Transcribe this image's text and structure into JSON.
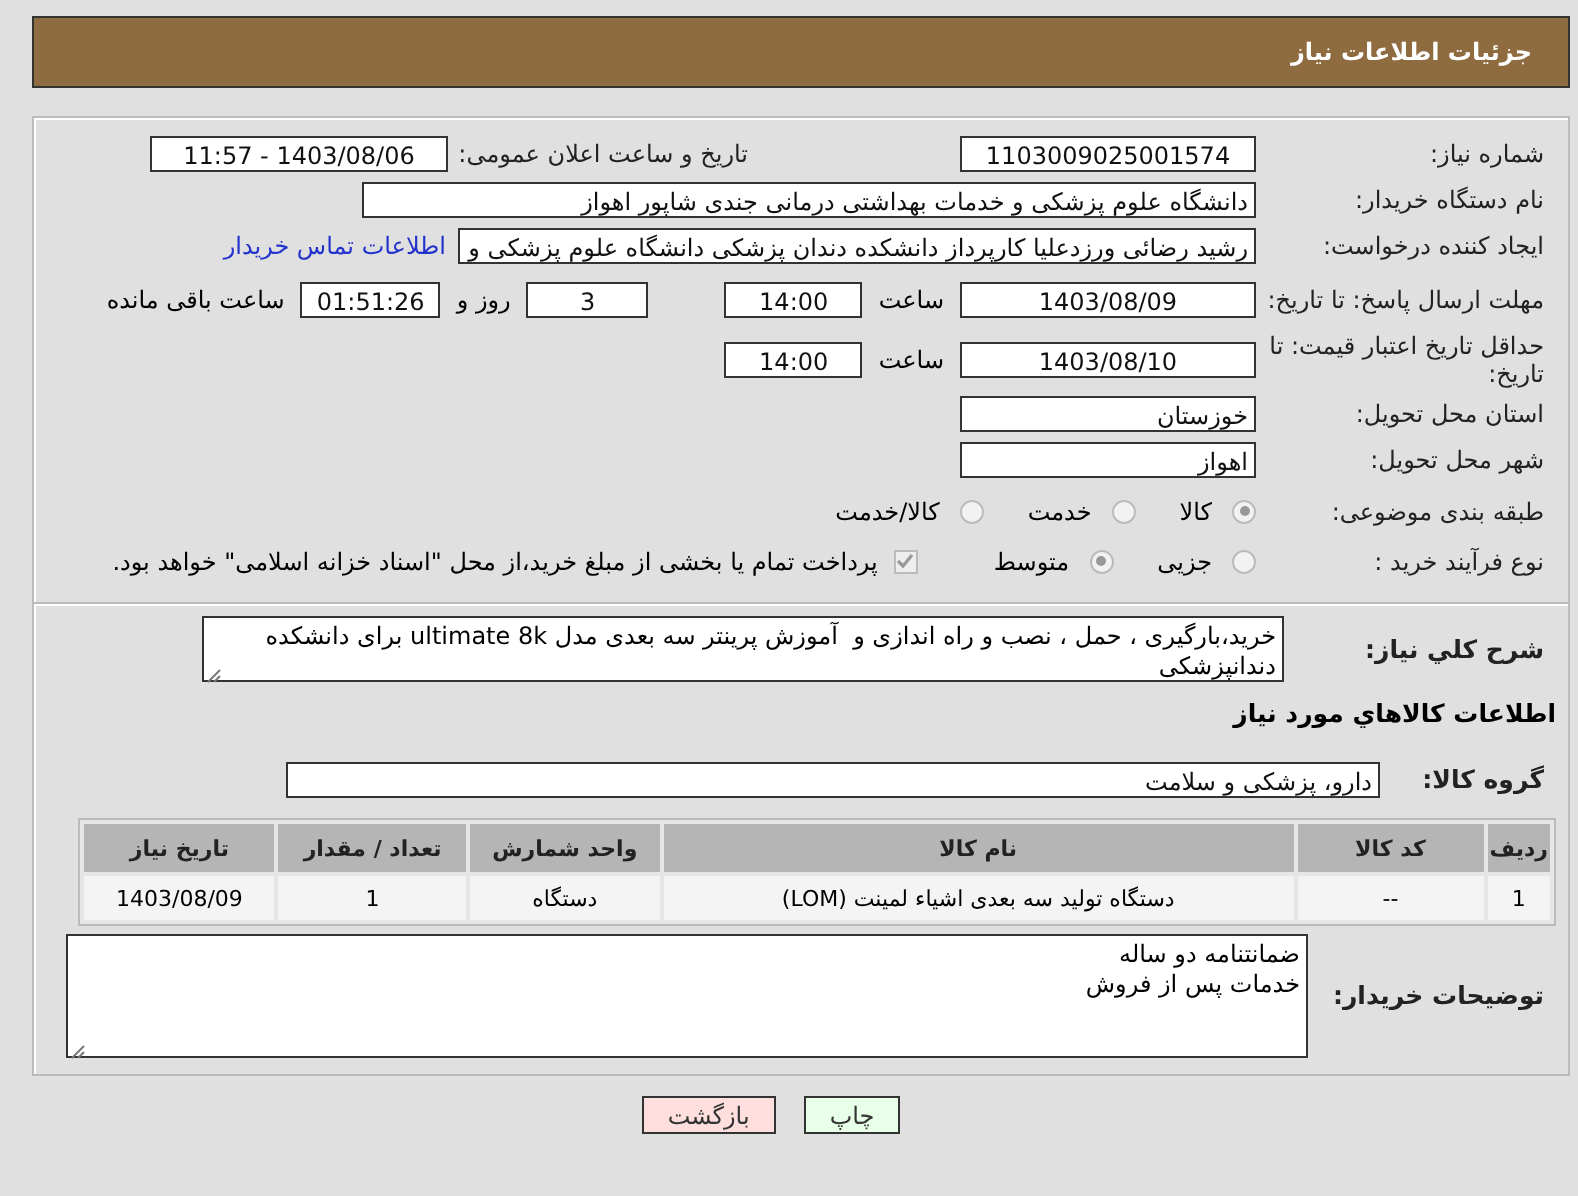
{
  "header": {
    "title": "جزئیات اطلاعات نیاز"
  },
  "need_number": {
    "label": "شماره نیاز:",
    "value": "1103009025001574"
  },
  "announce": {
    "label": "تاریخ و ساعت اعلان عمومی:",
    "value": "1403/08/06 - 11:57"
  },
  "buyer": {
    "label": "نام دستگاه خریدار:",
    "value": "دانشگاه علوم پزشکی و خدمات بهداشتی درمانی جندی شاپور اهواز"
  },
  "requester": {
    "label": "ایجاد کننده درخواست:",
    "value": "رشید رضائی ورزدعلیا کارپرداز دانشکده دندان پزشکی دانشگاه علوم پزشکی و",
    "link": "اطلاعات تماس خریدار"
  },
  "deadline": {
    "label": "مهلت ارسال پاسخ: تا تاریخ:",
    "date": "1403/08/09",
    "time_label": "ساعت",
    "time": "14:00",
    "days": "3",
    "days_label": "روز و",
    "remaining": "01:51:26",
    "remaining_label": "ساعت باقی مانده"
  },
  "price_validity": {
    "label": "حداقل تاریخ اعتبار قیمت: تا تاریخ:",
    "date": "1403/08/10",
    "time_label": "ساعت",
    "time": "14:00"
  },
  "province": {
    "label": "استان محل تحویل:",
    "value": "خوزستان"
  },
  "city": {
    "label": "شهر محل تحویل:",
    "value": "اهواز"
  },
  "category": {
    "label": "طبقه بندی موضوعی:",
    "options": [
      {
        "label": "کالا",
        "selected": true
      },
      {
        "label": "خدمت",
        "selected": false
      },
      {
        "label": "کالا/خدمت",
        "selected": false
      }
    ]
  },
  "process": {
    "label": "نوع فرآیند خرید :",
    "options": [
      {
        "label": "جزیی",
        "selected": false
      },
      {
        "label": "متوسط",
        "selected": true
      }
    ],
    "payment": {
      "label": "پرداخت تمام یا بخشی از مبلغ خرید،از محل \"اسناد خزانه اسلامی\" خواهد بود.",
      "checked": true
    }
  },
  "description": {
    "label": "شرح کلي نياز:",
    "value": "خرید،بارگیری ، حمل ، نصب و راه اندازی و  آموزش پرینتر سه بعدی مدل ultimate 8k برای دانشکده دندانپزشکی"
  },
  "goods_heading": "اطلاعات کالاهاي مورد نياز",
  "group": {
    "label": "گروه کالا:",
    "value": "دارو، پزشکی و سلامت"
  },
  "table": {
    "columns": [
      "ردیف",
      "کد کالا",
      "نام کالا",
      "واحد شمارش",
      "تعداد / مقدار",
      "تاریخ نیاز"
    ],
    "rows": [
      [
        "1",
        "--",
        "دستگاه تولید سه بعدی اشیاء لمینت (LOM)",
        "دستگاه",
        "1",
        "1403/08/09"
      ]
    ]
  },
  "notes": {
    "label": "توضیحات خریدار:",
    "lines": [
      "ضمانتنامه دو ساله",
      "خدمات پس از فروش"
    ]
  },
  "buttons": [
    {
      "label": "چاپ",
      "kind": "print"
    },
    {
      "label": "بازگشت",
      "kind": "back"
    }
  ]
}
